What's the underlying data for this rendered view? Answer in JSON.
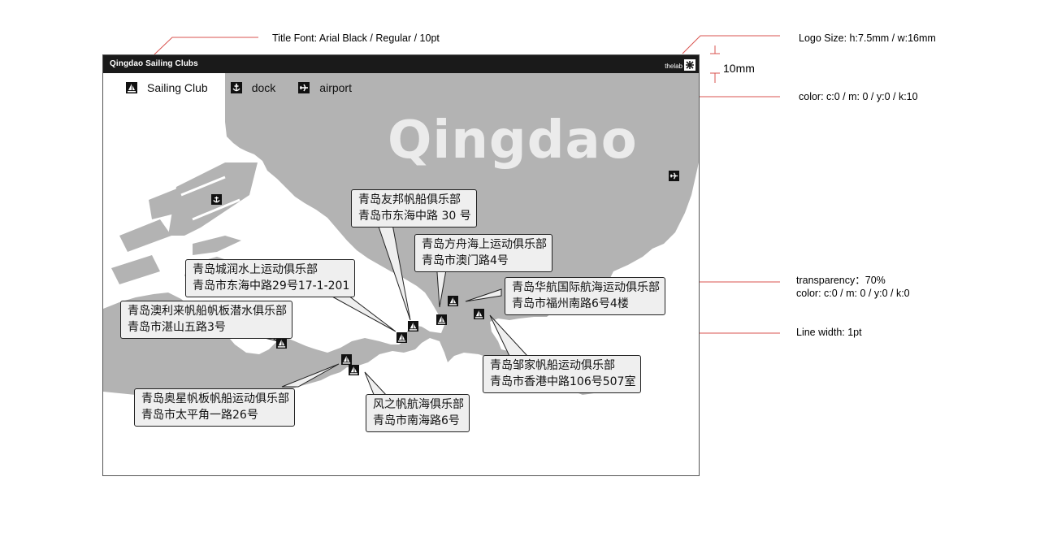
{
  "spec_notes": {
    "title_font": "Title Font: Arial Black / Regular / 10pt",
    "logo_size": "Logo Size:  h:7.5mm /  w:16mm",
    "bar_height": "10mm",
    "map_color": "color:  c:0 / m: 0 / y:0 / k:10",
    "transparency": "transparency：70%",
    "box_color": "color:  c:0 / m: 0 / y:0 / k:0",
    "line_width": "Line width: 1pt"
  },
  "map": {
    "title": "Qingdao Sailing Clubs",
    "logo_text": "thelab",
    "watermark": "Qingdao",
    "legend": [
      {
        "label": "Sailing Club",
        "icon": "sailboat-icon"
      },
      {
        "label": "dock",
        "icon": "anchor-icon"
      },
      {
        "label": "airport",
        "icon": "airplane-icon"
      }
    ],
    "clubs": [
      {
        "name": "青岛友邦帆船俱乐部",
        "address": "青岛市东海中路 30 号"
      },
      {
        "name": "青岛方舟海上运动俱乐部",
        "address": "青岛市澳门路4号"
      },
      {
        "name": "青岛城润水上运动俱乐部",
        "address": "青岛市东海中路29号17-1-201"
      },
      {
        "name": "青岛华航国际航海运动俱乐部",
        "address": "青岛市福州南路6号4楼"
      },
      {
        "name": "青岛澳利来帆船帆板潜水俱乐部",
        "address": "青岛市湛山五路3号"
      },
      {
        "name": "青岛邹家帆船运动俱乐部",
        "address": "青岛市香港中路106号507室"
      },
      {
        "name": "青岛奥星帆板帆船运动俱乐部",
        "address": "青岛市太平角一路26号"
      },
      {
        "name": "风之帆航海俱乐部",
        "address": "青岛市南海路6号"
      }
    ],
    "colors": {
      "land": "#b3b3b3",
      "label_bg": "#efefef",
      "title_bar": "#1a1a1a",
      "annotation_line": "#d9534f"
    }
  }
}
